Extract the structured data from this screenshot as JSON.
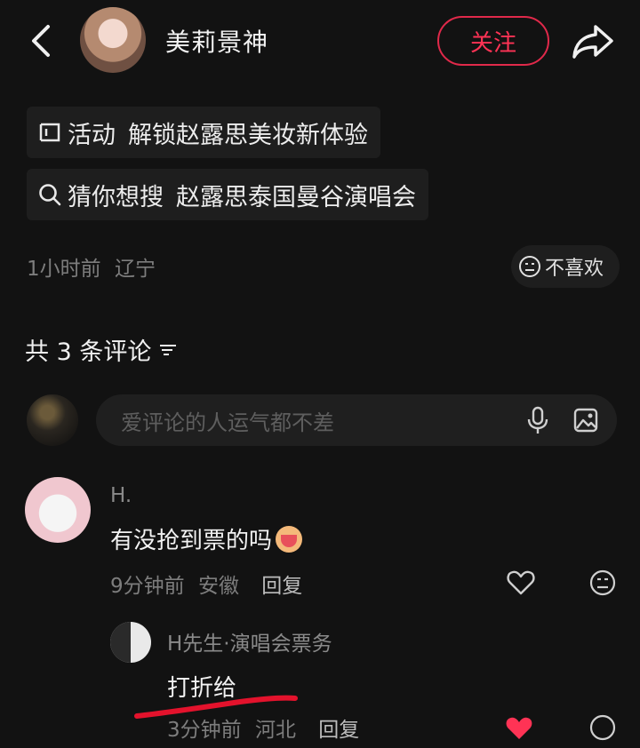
{
  "header": {
    "author_name": "美莉景神",
    "follow_label": "关注"
  },
  "chips": [
    {
      "tag": "活动",
      "text": "解锁赵露思美妆新体验",
      "icon": "ad-icon"
    },
    {
      "tag": "猜你想搜",
      "text": "赵露思泰国曼谷演唱会",
      "icon": "search-icon"
    }
  ],
  "post_meta": {
    "time": "1小时前",
    "location": "辽宁",
    "dislike_label": "不喜欢"
  },
  "comments_header": {
    "count_text": "共 3 条评论"
  },
  "comment_input": {
    "placeholder": "爱评论的人运气都不差"
  },
  "comments": [
    {
      "user": "H.",
      "text": "有没抢到票的吗",
      "time": "9分钟前",
      "location": "安徽",
      "reply_label": "回复",
      "replies": [
        {
          "user": "H先生·演唱会票务",
          "text": "打折给",
          "time": "3分钟前",
          "location": "河北",
          "reply_label": "回复"
        }
      ]
    }
  ],
  "colors": {
    "accent": "#ff3355",
    "background": "#121212",
    "underline": "#e3122c"
  }
}
